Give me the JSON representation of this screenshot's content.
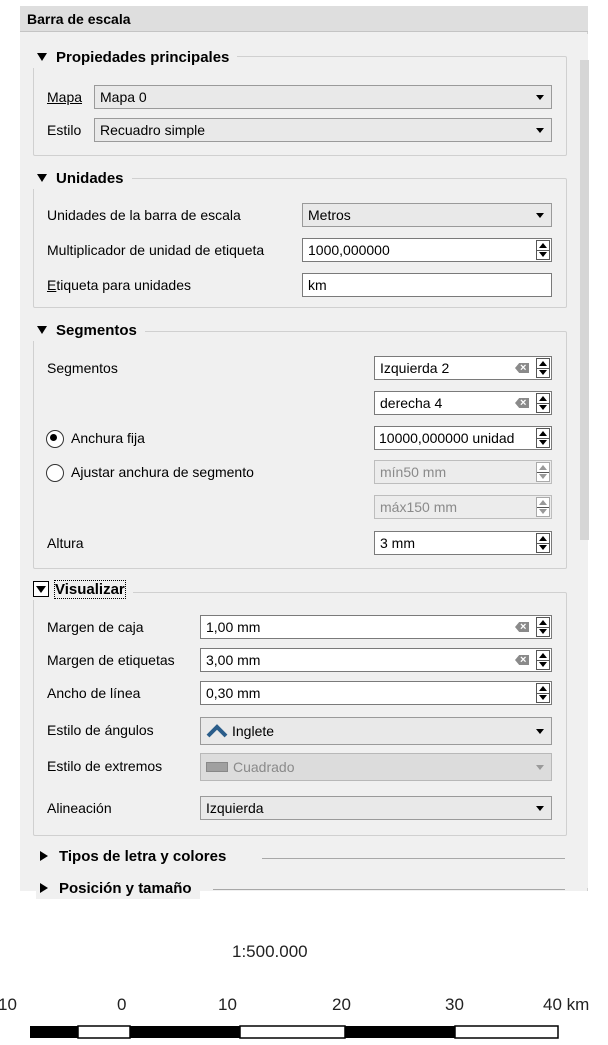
{
  "panel": {
    "title": "Barra de escala",
    "sections": {
      "main": {
        "title": "Propiedades principales",
        "map_label": "Mapa",
        "map_value": "Mapa 0",
        "style_label": "Estilo",
        "style_value": "Recuadro simple"
      },
      "units": {
        "title": "Unidades",
        "bar_units_label": "Unidades de la barra de escala",
        "bar_units_value": "Metros",
        "multiplier_label": "Multiplicador de unidad de etiqueta",
        "multiplier_value": "1000,000000",
        "unit_label_label": "Etiqueta para unidades",
        "unit_label_value": "km"
      },
      "segments": {
        "title": "Segmentos",
        "segments_label": "Segmentos",
        "left_value": "Izquierda 2",
        "right_value": "derecha 4",
        "fixed_width_label": "Anchura fija",
        "fixed_width_value": "10000,000000 unidad",
        "fit_width_label": "Ajustar anchura de segmento",
        "min_value": "mín50 mm",
        "max_value": "máx150 mm",
        "height_label": "Altura",
        "height_value": "3 mm"
      },
      "display": {
        "title": "Visualizar",
        "box_margin_label": "Margen de caja",
        "box_margin_value": "1,00 mm",
        "label_margin_label": "Margen de etiquetas",
        "label_margin_value": "3,00 mm",
        "line_width_label": "Ancho de línea",
        "line_width_value": "0,30 mm",
        "join_style_label": "Estilo de ángulos",
        "join_style_value": "Inglete",
        "cap_style_label": "Estilo de extremos",
        "cap_style_value": "Cuadrado",
        "alignment_label": "Alineación",
        "alignment_value": "Izquierda"
      },
      "fonts": {
        "title": "Tipos de letra y colores"
      },
      "position": {
        "title": "Posición y tamaño"
      }
    }
  },
  "scalebar": {
    "ratio": "1:500.000",
    "ticks": [
      "10",
      "0",
      "10",
      "20",
      "30",
      "40 km"
    ]
  }
}
